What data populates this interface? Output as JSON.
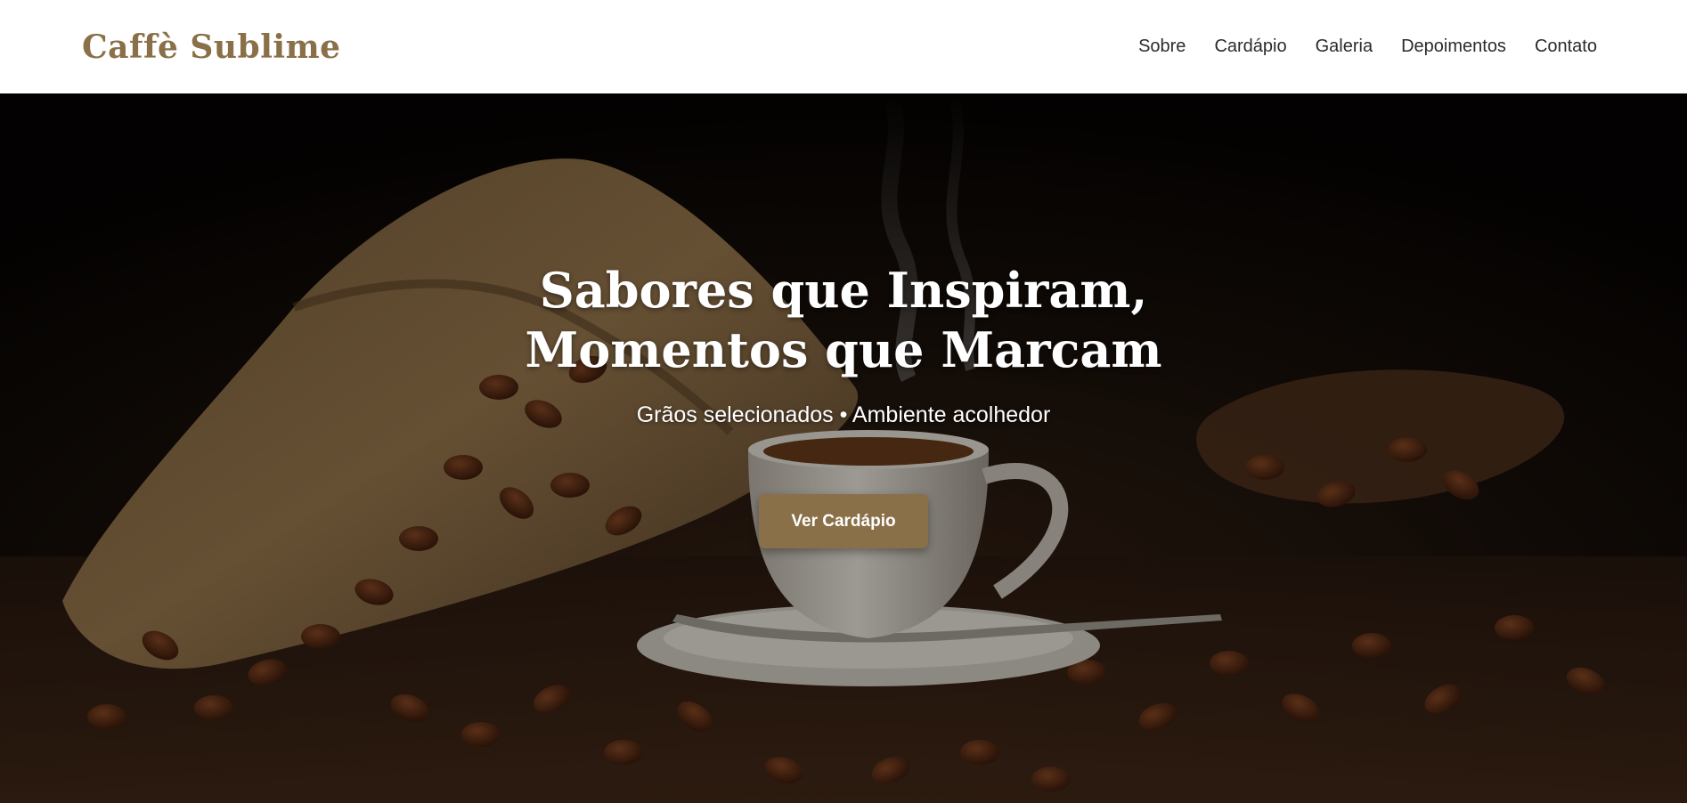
{
  "header": {
    "logo": "Caffè Sublime",
    "nav": [
      {
        "label": "Sobre"
      },
      {
        "label": "Cardápio"
      },
      {
        "label": "Galeria"
      },
      {
        "label": "Depoimentos"
      },
      {
        "label": "Contato"
      }
    ]
  },
  "hero": {
    "title": "Sabores que Inspiram, Momentos que Marcam",
    "subtitle": "Grãos selecionados • Ambiente acolhedor",
    "cta_label": "Ver Cardápio",
    "background_image": "coffee-cup-beans-burlap-sack-photo"
  },
  "colors": {
    "accent": "#8a7048",
    "header_bg": "#ffffff",
    "nav_text": "#2b2b2b",
    "hero_text": "#ffffff"
  }
}
